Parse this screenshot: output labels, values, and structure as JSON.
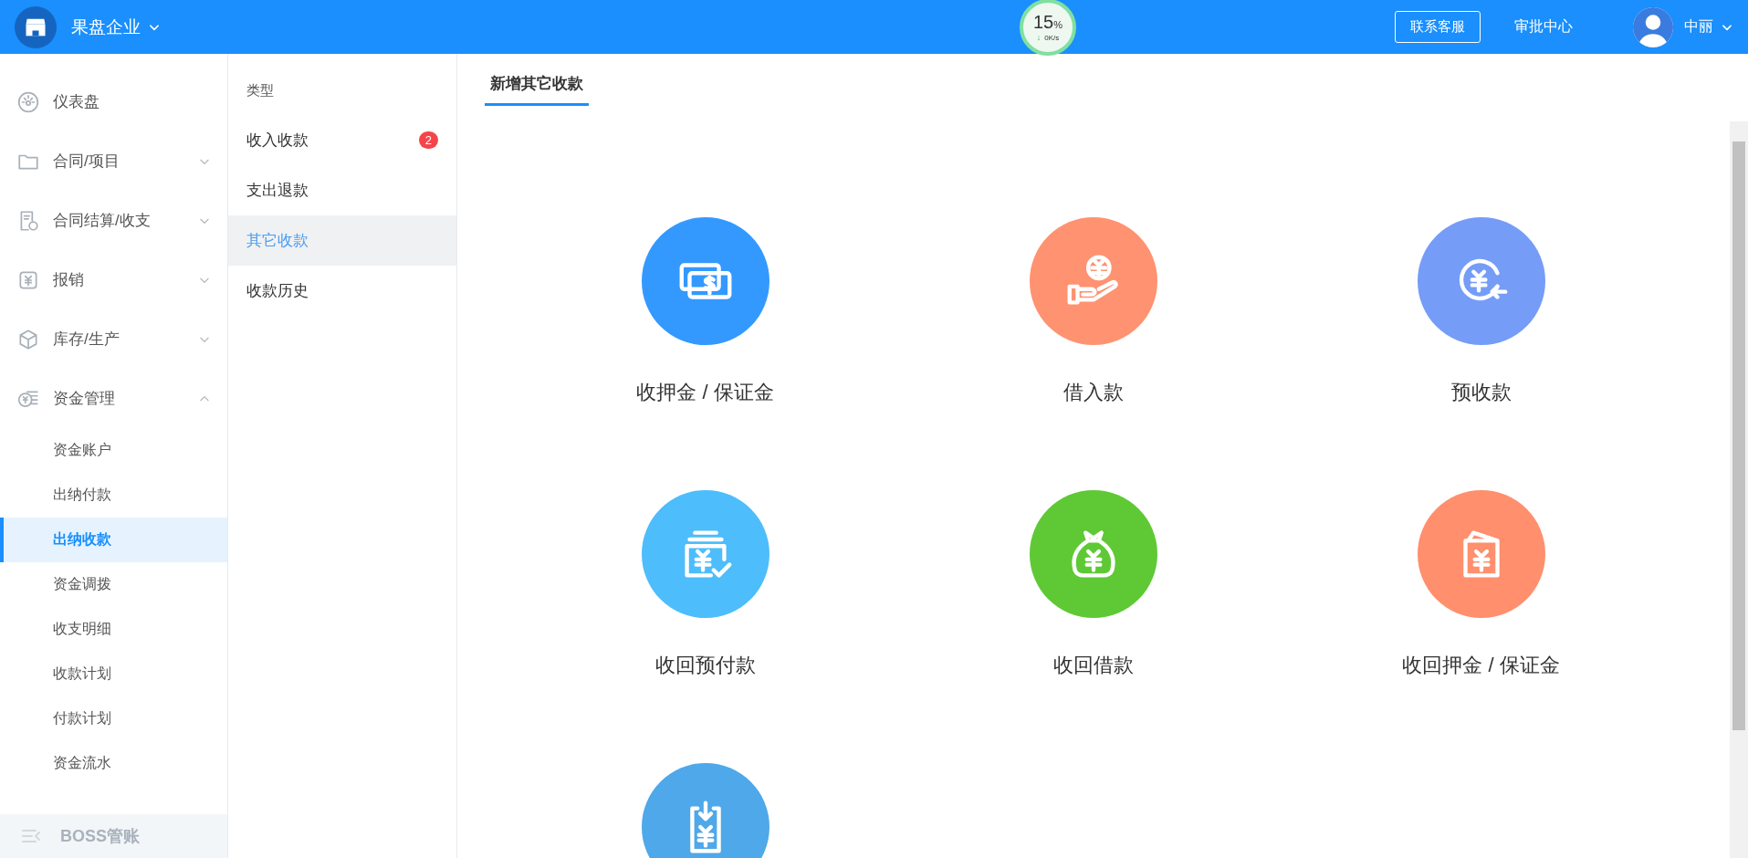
{
  "header": {
    "company": "果盘企业",
    "speed": {
      "percent": "15",
      "percent_sign": "%",
      "arrow": "↓",
      "rate": "0K/s"
    },
    "contact_button": "联系客服",
    "approval_link": "审批中心",
    "user": "中丽"
  },
  "sidebar": {
    "items": [
      {
        "label": "仪表盘"
      },
      {
        "label": "合同/项目",
        "expanded": false
      },
      {
        "label": "合同结算/收支",
        "expanded": false
      },
      {
        "label": "报销",
        "expanded": false
      },
      {
        "label": "库存/生产",
        "expanded": false
      },
      {
        "label": "资金管理",
        "expanded": true,
        "children": [
          {
            "label": "资金账户",
            "selected": false
          },
          {
            "label": "出纳付款",
            "selected": false
          },
          {
            "label": "出纳收款",
            "selected": true
          },
          {
            "label": "资金调拨",
            "selected": false
          },
          {
            "label": "收支明细",
            "selected": false
          },
          {
            "label": "收款计划",
            "selected": false
          },
          {
            "label": "付款计划",
            "selected": false
          },
          {
            "label": "资金流水",
            "selected": false
          }
        ]
      }
    ],
    "footer": "BOSS管账"
  },
  "types": {
    "heading": "类型",
    "items": [
      {
        "label": "收入收款",
        "selected": false,
        "badge": "2"
      },
      {
        "label": "支出退款",
        "selected": false
      },
      {
        "label": "其它收款",
        "selected": true
      },
      {
        "label": "收款历史",
        "selected": false
      }
    ]
  },
  "content": {
    "tab": "新增其它收款",
    "cards": [
      {
        "kind": "cash",
        "color": "#3399ff",
        "label": "收押金 / 保证金"
      },
      {
        "kind": "hand",
        "color": "#ff9270",
        "label": "借入款"
      },
      {
        "kind": "return",
        "color": "#759cf7",
        "label": "预收款"
      },
      {
        "kind": "wallet",
        "color": "#4dbdfb",
        "label": "收回预付款"
      },
      {
        "kind": "bag",
        "color": "#5ec935",
        "label": "收回借款"
      },
      {
        "kind": "card",
        "color": "#ff8f6d",
        "label": "收回押金 / 保证金"
      },
      {
        "kind": "inbox",
        "color": "#4ea8e9"
      }
    ]
  }
}
